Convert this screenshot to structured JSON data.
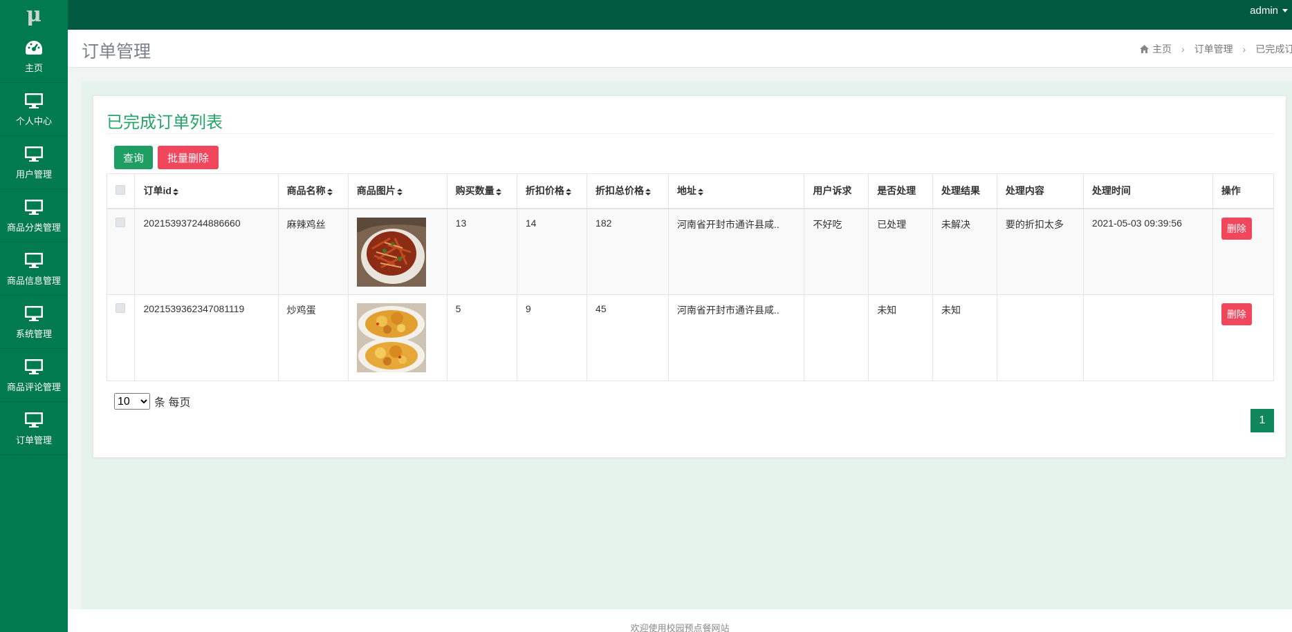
{
  "app": {
    "logo_text": "μ",
    "user_menu": "admin"
  },
  "sidebar": {
    "items": [
      {
        "label": "主页",
        "icon": "dashboard-icon"
      },
      {
        "label": "个人中心",
        "icon": "monitor-icon"
      },
      {
        "label": "用户管理",
        "icon": "monitor-icon"
      },
      {
        "label": "商品分类管理",
        "icon": "monitor-icon"
      },
      {
        "label": "商品信息管理",
        "icon": "monitor-icon"
      },
      {
        "label": "系统管理",
        "icon": "monitor-icon"
      },
      {
        "label": "商品评论管理",
        "icon": "monitor-icon"
      },
      {
        "label": "订单管理",
        "icon": "monitor-icon"
      }
    ]
  },
  "header": {
    "title": "订单管理",
    "breadcrumb": [
      "主页",
      "订单管理",
      "已完成订单"
    ]
  },
  "panel": {
    "title": "已完成订单列表",
    "query_button": "查询",
    "batch_delete_button": "批量删除"
  },
  "table": {
    "columns": [
      "订单id",
      "商品名称",
      "商品图片",
      "购买数量",
      "折扣价格",
      "折扣总价格",
      "地址",
      "用户诉求",
      "是否处理",
      "处理结果",
      "处理内容",
      "处理时间",
      "操作"
    ],
    "sortable": [
      true,
      true,
      true,
      true,
      true,
      true,
      true,
      false,
      false,
      false,
      false,
      false,
      false
    ],
    "rows": [
      {
        "order_id": "202153937244886660",
        "name": "麻辣鸡丝",
        "image": "food-photo-spicy-chicken",
        "qty": "13",
        "price": "14",
        "total": "182",
        "address": "河南省开封市通许县咸..",
        "request": "不好吃",
        "handled": "已处理",
        "result": "未解决",
        "content": "要的折扣太多",
        "time": "2021-05-03 09:39:56",
        "action": "删除"
      },
      {
        "order_id": "2021539362347081119",
        "name": "炒鸡蛋",
        "image": "food-photo-fried-egg",
        "qty": "5",
        "price": "9",
        "total": "45",
        "address": "河南省开封市通许县咸..",
        "request": "",
        "handled": "未知",
        "result": "未知",
        "content": "",
        "time": "",
        "action": "删除"
      }
    ]
  },
  "pagination": {
    "page_size": "10",
    "page_size_options": [
      "10"
    ],
    "page_size_suffix": "条 每页",
    "current_page": "1"
  },
  "footer": {
    "text": "欢迎使用校园预点餐网站"
  },
  "colors": {
    "topbar": "#015a40",
    "sidebar": "#027a4f",
    "accent_green": "#22a567",
    "danger": "#f1465c"
  }
}
